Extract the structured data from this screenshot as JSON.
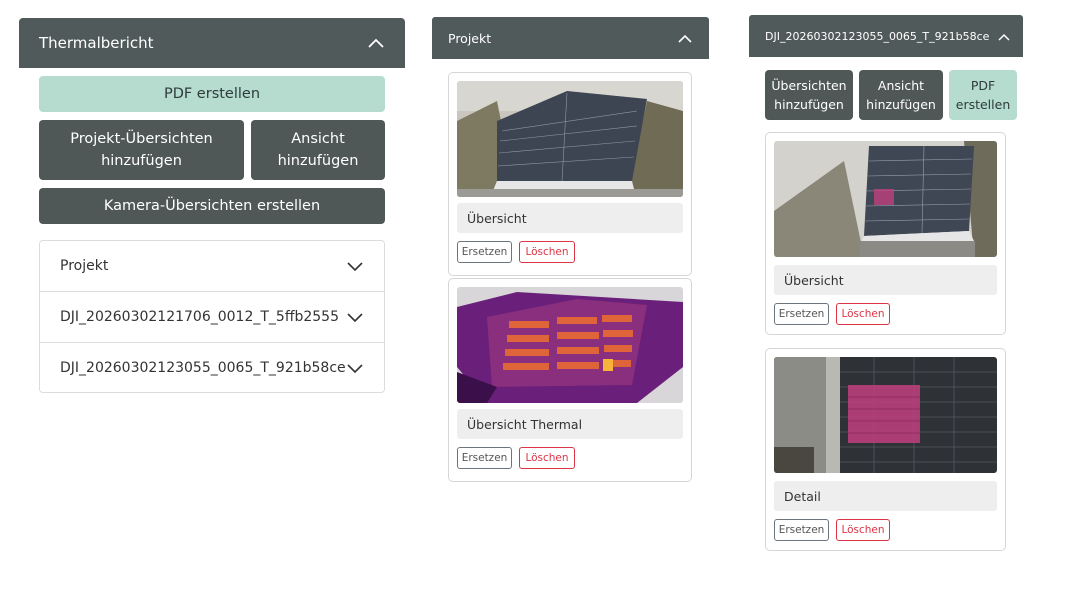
{
  "left": {
    "title": "Thermalbericht",
    "pdf_label": "PDF erstellen",
    "project_overviews_label": "Projekt-Übersichten hinzufügen",
    "add_view_label": "Ansicht hinzufügen",
    "camera_overviews_label": "Kamera-Übersichten erstellen",
    "accordion": [
      {
        "label": "Projekt"
      },
      {
        "label": "DJI_20260302121706_0012_T_5ffb2555"
      },
      {
        "label": "DJI_20260302123055_0065_T_921b58ce"
      }
    ]
  },
  "middle": {
    "title": "Projekt",
    "cards": [
      {
        "caption": "Übersicht",
        "replace": "Ersetzen",
        "delete": "Löschen",
        "image": "roof-rgb-overview"
      },
      {
        "caption": "Übersicht Thermal",
        "replace": "Ersetzen",
        "delete": "Löschen",
        "image": "roof-thermal-overview"
      }
    ]
  },
  "right": {
    "title": "DJI_20260302123055_0065_T_921b58ce",
    "overviews_label": "Übersichten hinzufügen",
    "add_view_label": "Ansicht hinzufügen",
    "pdf_label": "PDF erstellen",
    "cards": [
      {
        "caption": "Übersicht",
        "replace": "Ersetzen",
        "delete": "Löschen",
        "image": "roof-rgb-marked"
      },
      {
        "caption": "Detail",
        "replace": "Ersetzen",
        "delete": "Löschen",
        "image": "roof-detail-thermal"
      }
    ]
  },
  "colors": {
    "header": "#505a5a",
    "dark_button": "#4f5757",
    "green_button": "#b5dccf",
    "danger": "#dc3545"
  }
}
